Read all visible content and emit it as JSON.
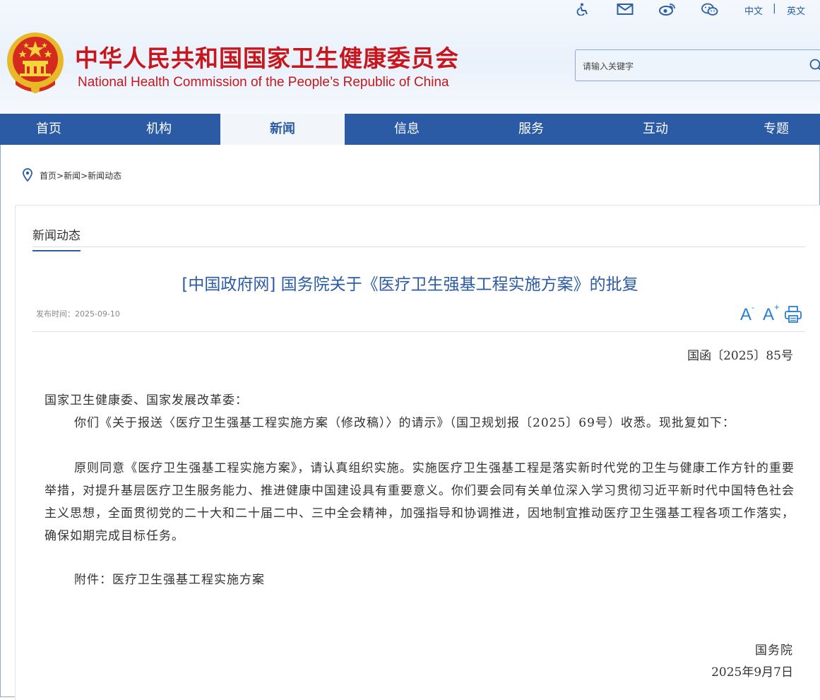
{
  "header": {
    "title_cn": "中华人民共和国国家卫生健康委员会",
    "title_en": "National Health Commission of the People’s  Republic of China",
    "lang_cn": "中文",
    "lang_sep": "|",
    "lang_en": "英文",
    "search_placeholder": "请输入关键字"
  },
  "nav": {
    "items": [
      {
        "label": "首页"
      },
      {
        "label": "机构"
      },
      {
        "label": "新闻"
      },
      {
        "label": "信息"
      },
      {
        "label": "服务"
      },
      {
        "label": "互动"
      },
      {
        "label": "专题"
      }
    ],
    "active_index": 2
  },
  "breadcrumb": {
    "home": "首页",
    "sep": ">",
    "news": "新闻",
    "current": "新闻动态"
  },
  "section_title": "新闻动态",
  "article": {
    "title": "[中国政府网] 国务院关于《医疗卫生强基工程实施方案》的批复",
    "pub_label": "发布时间：",
    "pub_date": "2025-09-10",
    "doc_number": "国函〔2025〕85号",
    "salutation": "国家卫生健康委、国家发展改革委：",
    "para1": "你们《关于报送〈医疗卫生强基工程实施方案（修改稿）〉的请示》（国卫规划报〔2025〕69号）收悉。现批复如下：",
    "para2": "原则同意《医疗卫生强基工程实施方案》，请认真组织实施。实施医疗卫生强基工程是落实新时代党的卫生与健康工作方针的重要举措，对提升基层医疗卫生服务能力、推进健康中国建设具有重要意义。你们要会同有关单位深入学习贯彻习近平新时代中国特色社会主义思想，全面贯彻党的二十大和二十届二中、三中全会精神，加强指导和协调推进，因地制宜推动医疗卫生强基工程各项工作落实，确保如期完成目标任务。",
    "attachment": "附件：医疗卫生强基工程实施方案",
    "signer": "国务院",
    "sign_date": "2025年9月7日"
  },
  "tools": {
    "font_smaller": "A",
    "font_smaller_mark": "-",
    "font_larger": "A",
    "font_larger_mark": "+"
  },
  "colors": {
    "brand_red": "#c8161d",
    "nav_blue": "#2c5ba5",
    "link_blue": "#2b7fd3"
  },
  "icons": [
    "accessibility-icon",
    "mail-icon",
    "weibo-icon",
    "wechat-icon",
    "search-icon",
    "location-pin-icon",
    "print-icon",
    "national-emblem"
  ]
}
